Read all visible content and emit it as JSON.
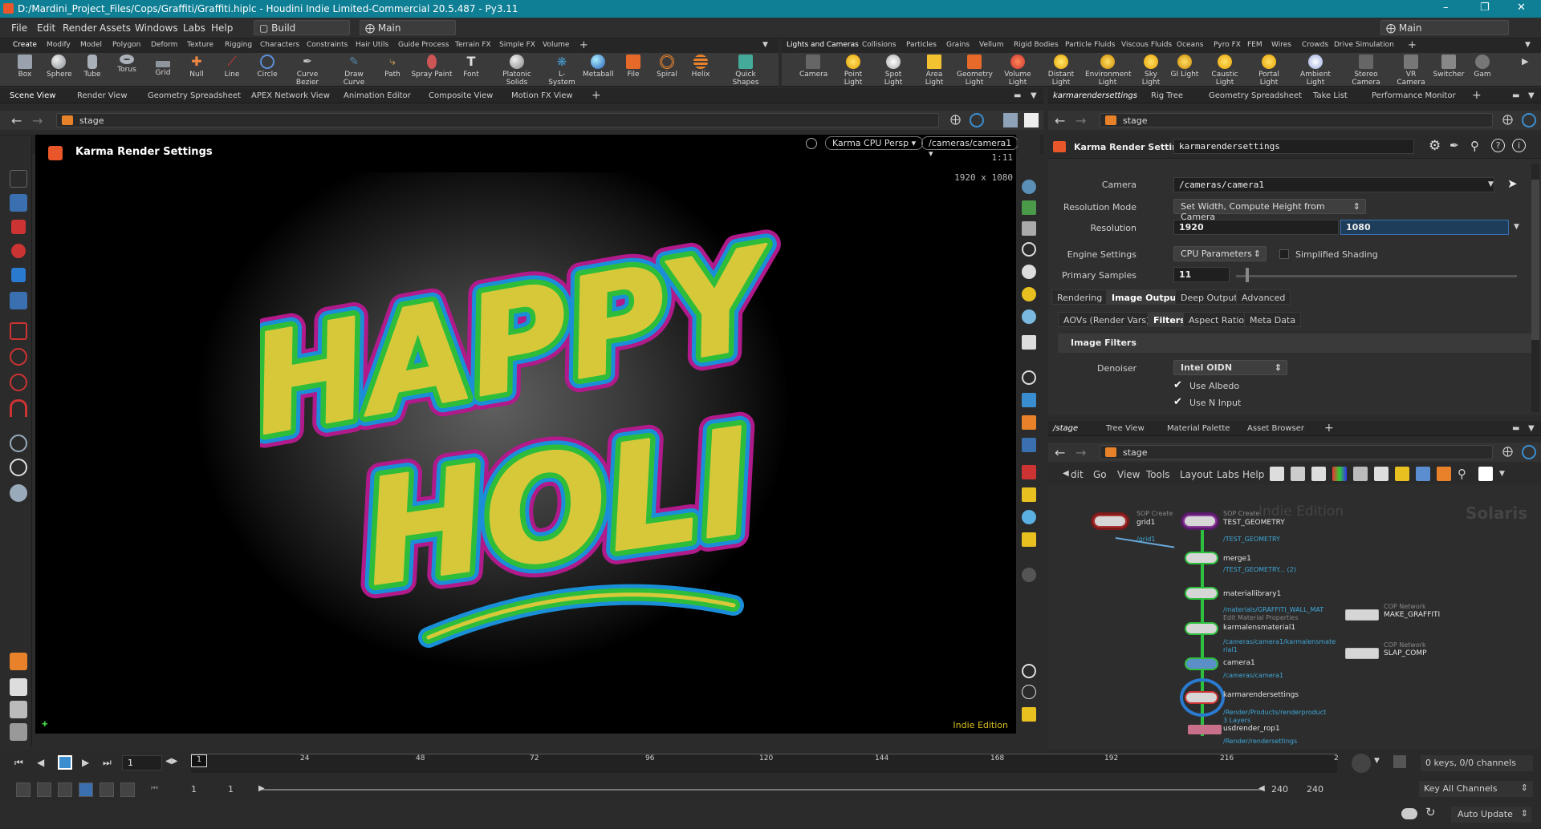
{
  "window": {
    "title": "D:/Mardini_Project_Files/Cops/Graffiti/Graffiti.hiplc - Houdini Indie Limited-Commercial 20.5.487 - Py3.11"
  },
  "menu": {
    "items": [
      "File",
      "Edit",
      "Render",
      "Assets",
      "Windows",
      "Labs",
      "Help"
    ],
    "desktop": "Build",
    "layout": "Main",
    "right_layout": "Main"
  },
  "shelf_left": {
    "tabs": [
      "Create",
      "Modify",
      "Model",
      "Polygon",
      "Deform",
      "Texture",
      "Rigging",
      "Characters",
      "Constraints",
      "Hair Utils",
      "Guide Process",
      "Terrain FX",
      "Simple FX",
      "Volume"
    ],
    "tools": [
      "Box",
      "Sphere",
      "Tube",
      "Torus",
      "Grid",
      "Null",
      "Line",
      "Circle",
      "Curve Bezier",
      "Draw Curve",
      "Path",
      "Spray Paint",
      "Font",
      "Platonic Solids",
      "L-System",
      "Metaball",
      "File",
      "Spiral",
      "Helix",
      "Quick Shapes"
    ]
  },
  "shelf_right": {
    "tabs": [
      "Lights and Cameras",
      "Collisions",
      "Particles",
      "Grains",
      "Vellum",
      "Rigid Bodies",
      "Particle Fluids",
      "Viscous Fluids",
      "Oceans",
      "Pyro FX",
      "FEM",
      "Wires",
      "Crowds",
      "Drive Simulation"
    ],
    "tools": [
      "Camera",
      "Point Light",
      "Spot Light",
      "Area Light",
      "Geometry Light",
      "Volume Light",
      "Distant Light",
      "Environment Light",
      "Sky Light",
      "GI Light",
      "Caustic Light",
      "Portal Light",
      "Ambient Light",
      "Stereo Camera",
      "VR Camera",
      "Switcher",
      "Gam"
    ]
  },
  "left_panes": {
    "tabs": [
      "Scene View",
      "Render View",
      "Geometry Spreadsheet",
      "APEX Network View",
      "Animation Editor",
      "Composite View",
      "Motion FX View"
    ],
    "path": "stage"
  },
  "viewport": {
    "title": "Karma Render Settings",
    "renderer": "Karma CPU  Persp",
    "camera": "/cameras/camera1",
    "ratio": "1:11",
    "resolution": "1920 x 1080",
    "watermark": "Indie Edition",
    "graffiti_text": [
      "HAPPY",
      "HOLI"
    ]
  },
  "right_top": {
    "tabs": [
      "karmarendersettings",
      "Rig Tree",
      "Geometry Spreadsheet",
      "Take List",
      "Performance Monitor"
    ],
    "path": "stage",
    "node_type": "Karma Render Settings",
    "node_name": "karmarendersettings",
    "camera_label": "Camera",
    "camera_value": "/cameras/camera1",
    "resmode_label": "Resolution Mode",
    "resmode_value": "Set Width, Compute Height from Camera",
    "resolution_label": "Resolution",
    "res_w": "1920",
    "res_h": "1080",
    "engine_label": "Engine Settings",
    "engine_value": "CPU Parameters",
    "simplified": "Simplified Shading",
    "samples_label": "Primary Samples",
    "samples_value": "11",
    "tabs1": [
      "Rendering",
      "Image Output",
      "Deep Output",
      "Advanced"
    ],
    "tabs2": [
      "AOVs (Render Vars)",
      "Filters",
      "Aspect Ratio",
      "Meta Data"
    ],
    "section": "Image Filters",
    "denoiser_label": "Denoiser",
    "denoiser_value": "Intel OIDN",
    "use_albedo": "Use Albedo",
    "use_n": "Use N Input"
  },
  "network": {
    "tabs": [
      "/stage",
      "Tree View",
      "Material Palette",
      "Asset Browser"
    ],
    "path": "stage",
    "menu": [
      "dit",
      "Go",
      "View",
      "Tools",
      "Layout",
      "Labs",
      "Help"
    ],
    "watermark1": "Indie Edition",
    "watermark2": "Solaris",
    "nodes": {
      "grid1": {
        "type": "SOP Create",
        "name": "grid1",
        "sub": "/grid1"
      },
      "test": {
        "type": "SOP Create",
        "name": "TEST_GEOMETRY",
        "sub": "/TEST_GEOMETRY"
      },
      "merge": {
        "name": "merge1",
        "sub": "/TEST_GEOMETRY... (2)"
      },
      "matlib": {
        "name": "materiallibrary1",
        "sub": "/materials/GRAFFITI_WALL_MAT",
        "sub2": "Edit Material Properties"
      },
      "karmalens": {
        "name": "karmalensmaterial1",
        "sub": "/cameras/camera1/karmalensmate",
        "sub2": "rial1"
      },
      "camera": {
        "name": "camera1",
        "sub": "/cameras/camera1"
      },
      "krs": {
        "name": "karmarendersettings",
        "sub": "/Render/Products/renderproduct",
        "sub2": "3 Layers"
      },
      "rop": {
        "name": "usdrender_rop1",
        "sub": "/Render/rendersettings"
      },
      "cop1": {
        "type": "COP Network",
        "name": "MAKE_GRAFFITI"
      },
      "cop2": {
        "type": "COP Network",
        "name": "SLAP_COMP"
      }
    }
  },
  "timeline": {
    "ticks": [
      "24",
      "48",
      "72",
      "96",
      "120",
      "144",
      "168",
      "192",
      "216",
      "2"
    ],
    "current_frame": "1",
    "frame_marker": "1",
    "start": "1",
    "start2": "1",
    "end": "240",
    "end2": "240",
    "keys": "0 keys, 0/0 channels",
    "key_all": "Key All Channels",
    "auto_update": "Auto Update"
  }
}
